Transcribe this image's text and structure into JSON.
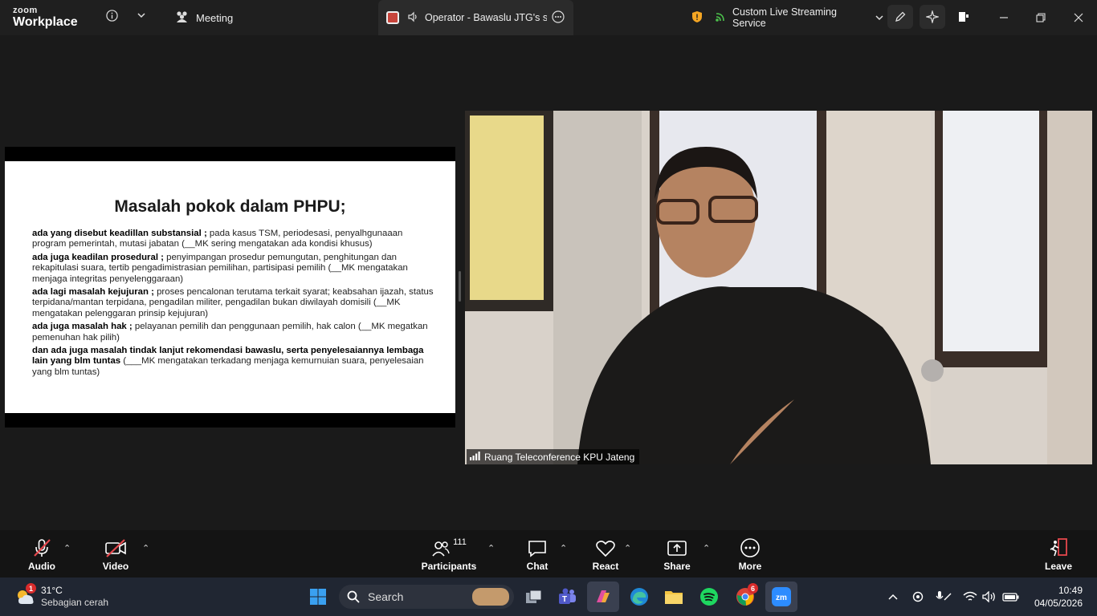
{
  "app": {
    "brand_top": "zoom",
    "brand_bottom": "Workplace"
  },
  "tabs": {
    "meeting_label": "Meeting",
    "screen_share_label": "Operator - Bawaslu JTG's scre",
    "streaming_label": "Custom Live Streaming Service"
  },
  "slide": {
    "title": "Masalah pokok dalam PHPU;",
    "items": [
      {
        "bold": "ada yang disebut keadillan substansial ;",
        "text": " pada kasus TSM, periodesasi, penyalhgunaaan program pemerintah, mutasi jabatan (__MK sering mengatakan ada kondisi khusus)"
      },
      {
        "bold": "ada juga keadilan prosedural ;",
        "text": "  penyimpangan prosedur pemungutan, penghitungan dan rekapitulasi suara, tertib pengadimistrasian pemilihan, partisipasi pemilih (__MK mengatakan menjaga integritas penyelenggaraan)"
      },
      {
        "bold": "ada lagi masalah kejujuran ;",
        "text": "  proses pencalonan terutama terkait syarat; keabsahan ijazah, status terpidana/mantan terpidana, pengadilan militer, pengadilan bukan diwilayah domisili (__MK mengatakan pelenggaran prinsip kejujuran)"
      },
      {
        "bold": "ada juga masalah hak ;",
        "text": " pelayanan pemilih dan penggunaan pemilih, hak calon (__MK megatkan pemenuhan hak pilih)"
      },
      {
        "bold": "dan ada juga masalah tindak lanjut rekomendasi bawaslu, serta penyelesaiannya lembaga lain yang blm tuntas",
        "text": " (___MK mengatakan terkadang menjaga kemurnuian suara, penyelesaian yang blm tuntas)"
      }
    ]
  },
  "video": {
    "participant_name": "Ruang Teleconference KPU Jateng"
  },
  "toolbar": {
    "audio_label": "Audio",
    "video_label": "Video",
    "participants_label": "Participants",
    "participants_count": "111",
    "chat_label": "Chat",
    "react_label": "React",
    "share_label": "Share",
    "more_label": "More",
    "leave_label": "Leave"
  },
  "taskbar": {
    "weather_temp": "31°C",
    "weather_desc": "Sebagian cerah",
    "weather_badge": "1",
    "search_placeholder": "Search",
    "chrome_badge": "6",
    "time": "10:49",
    "date": "04/05/2026"
  },
  "colors": {
    "topbar_bg": "#1f1f1f",
    "stage_bg": "#1a1a1a",
    "toolbar_bg": "#141414",
    "taskbar_bg": "#202632",
    "mute_red": "#e5484d",
    "shield_orange": "#f5a623",
    "live_green": "#4cc24c"
  }
}
